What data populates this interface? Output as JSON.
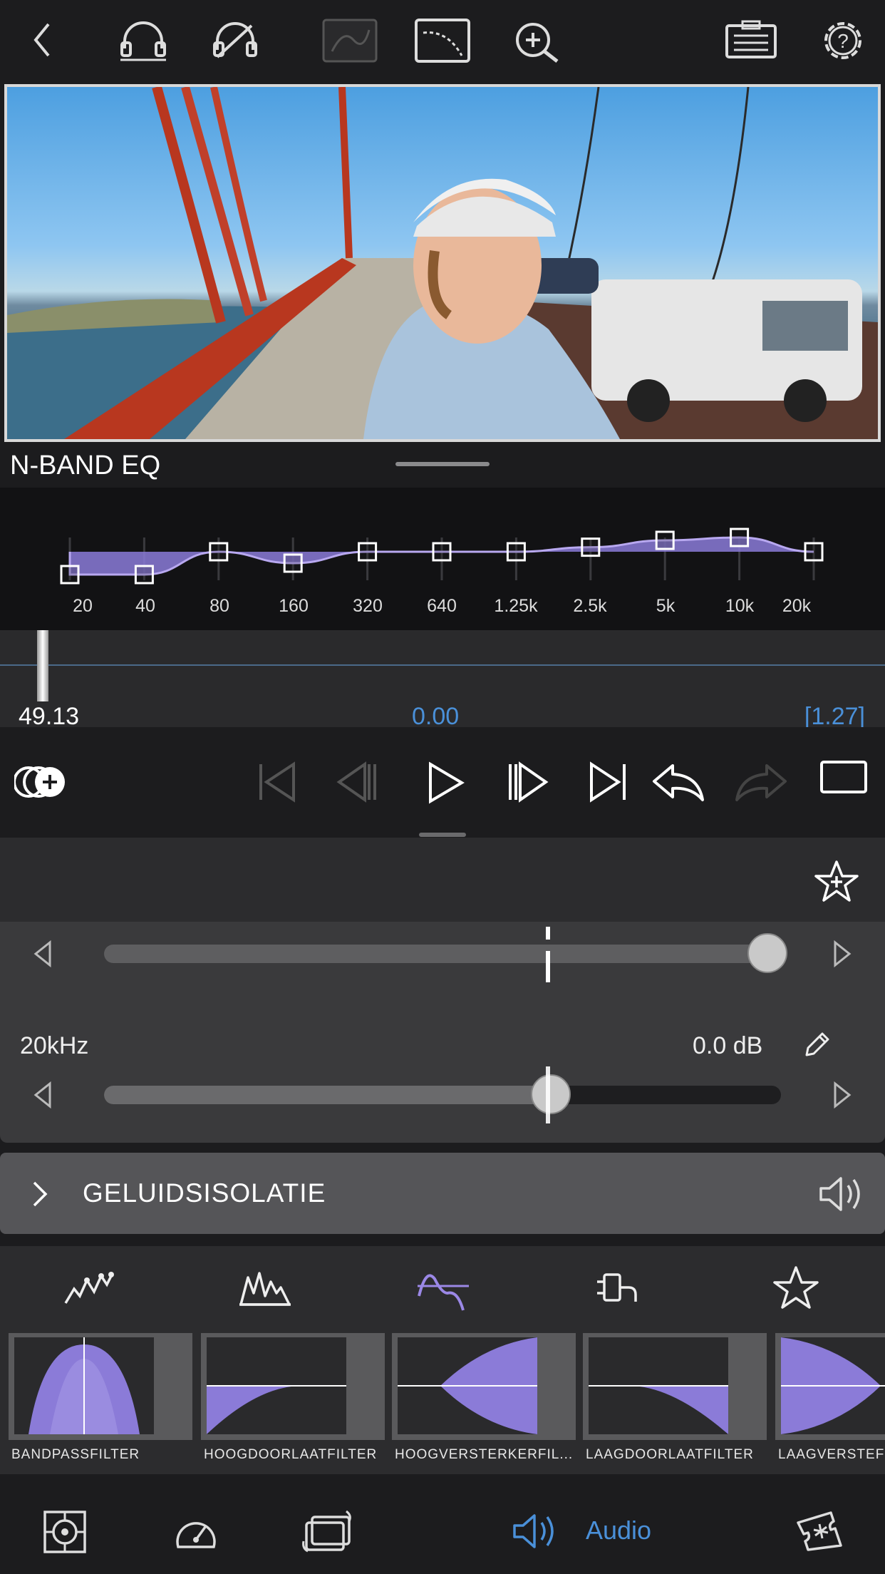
{
  "toolbar": {
    "icons": [
      "back-icon",
      "headphones-icon",
      "headphones-off-icon",
      "keyframe-curve-icon",
      "curve-icon",
      "zoom-in-icon",
      "clipboard-icon",
      "settings-help-icon"
    ]
  },
  "eq": {
    "title": "N-BAND EQ",
    "bands": [
      "20",
      "40",
      "80",
      "160",
      "320",
      "640",
      "1.25k",
      "2.5k",
      "5k",
      "10k",
      "20k"
    ],
    "band_gains_db": [
      -4,
      -4,
      0,
      -2,
      0,
      0,
      0,
      0.8,
      2,
      2.5,
      0
    ]
  },
  "timeline": {
    "current_time": "49.13",
    "offset": "0.00",
    "duration": "[1.27]"
  },
  "effect": {
    "slider1_value": 0.98,
    "frequency_label": "20kHz",
    "gain_label": "0.0 dB",
    "slider2_value": 0.66
  },
  "isolation": {
    "label": "GELUIDSISOLATIE"
  },
  "categories": [
    "waveform-peaks-icon",
    "spectrum-icon",
    "filter-curve-icon",
    "plug-icon",
    "favorites-star-icon"
  ],
  "presets": [
    "BANDPASSFILTER",
    "HOOGDOORLAATFILTER",
    "HOOGVERSTERKERFIL...",
    "LAAGDOORLAATFILTER",
    "LAAGVERSTEF"
  ],
  "bottom": {
    "audio_label": "Audio"
  },
  "colors": {
    "accent": "#4a90d9",
    "eq_fill": "#8b7bd8",
    "purple_active": "#9b88e6"
  }
}
